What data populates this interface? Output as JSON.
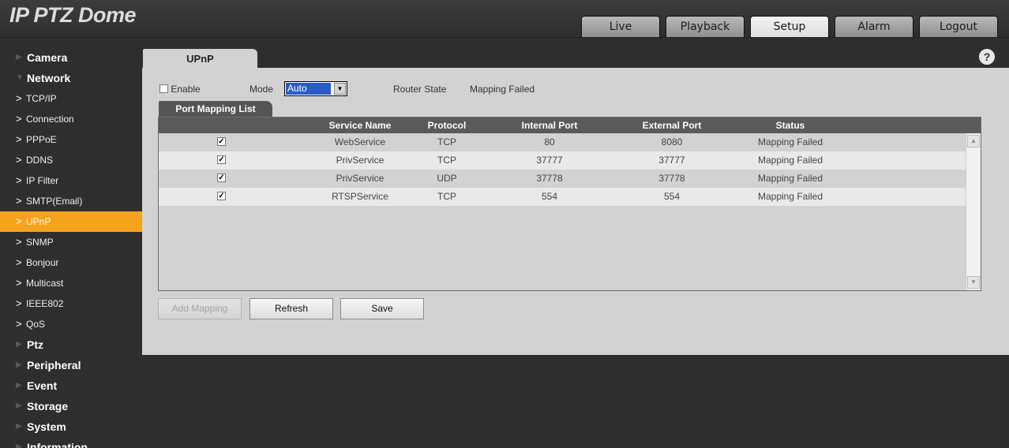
{
  "app": {
    "title": "IP PTZ Dome"
  },
  "top_tabs": [
    {
      "label": "Live",
      "active": false
    },
    {
      "label": "Playback",
      "active": false
    },
    {
      "label": "Setup",
      "active": true
    },
    {
      "label": "Alarm",
      "active": false
    },
    {
      "label": "Logout",
      "active": false
    }
  ],
  "sidebar": {
    "groups_before": [
      {
        "label": "Camera"
      }
    ],
    "network": {
      "label": "Network",
      "items": [
        {
          "label": "TCP/IP"
        },
        {
          "label": "Connection"
        },
        {
          "label": "PPPoE"
        },
        {
          "label": "DDNS"
        },
        {
          "label": "IP Filter"
        },
        {
          "label": "SMTP(Email)"
        },
        {
          "label": "UPnP",
          "active": true
        },
        {
          "label": "SNMP"
        },
        {
          "label": "Bonjour"
        },
        {
          "label": "Multicast"
        },
        {
          "label": "IEEE802"
        },
        {
          "label": "QoS"
        }
      ]
    },
    "groups_after": [
      {
        "label": "Ptz"
      },
      {
        "label": "Peripheral"
      },
      {
        "label": "Event"
      },
      {
        "label": "Storage"
      },
      {
        "label": "System"
      },
      {
        "label": "Information"
      }
    ]
  },
  "content": {
    "tab": "UPnP",
    "help_glyph": "?",
    "enable_label": "Enable",
    "enable_checked": false,
    "mode_label": "Mode",
    "mode_value": "Auto",
    "router_state_label": "Router State",
    "router_state_value": "Mapping Failed",
    "port_mapping_tab": "Port Mapping List",
    "table": {
      "headers": [
        "Service Name",
        "Protocol",
        "Internal Port",
        "External Port",
        "Status"
      ],
      "rows": [
        {
          "checked": true,
          "service": "WebService",
          "protocol": "TCP",
          "internal": "80",
          "external": "8080",
          "status": "Mapping Failed"
        },
        {
          "checked": true,
          "service": "PrivService",
          "protocol": "TCP",
          "internal": "37777",
          "external": "37777",
          "status": "Mapping Failed"
        },
        {
          "checked": true,
          "service": "PrivService",
          "protocol": "UDP",
          "internal": "37778",
          "external": "37778",
          "status": "Mapping Failed"
        },
        {
          "checked": true,
          "service": "RTSPService",
          "protocol": "TCP",
          "internal": "554",
          "external": "554",
          "status": "Mapping Failed"
        }
      ]
    },
    "buttons": {
      "add_mapping": "Add Mapping",
      "refresh": "Refresh",
      "save": "Save"
    }
  },
  "colors": {
    "accent": "#f5a21c",
    "panel": "#d2d2d2",
    "background": "#2e2e2e",
    "select_highlight": "#2a5cc8"
  }
}
